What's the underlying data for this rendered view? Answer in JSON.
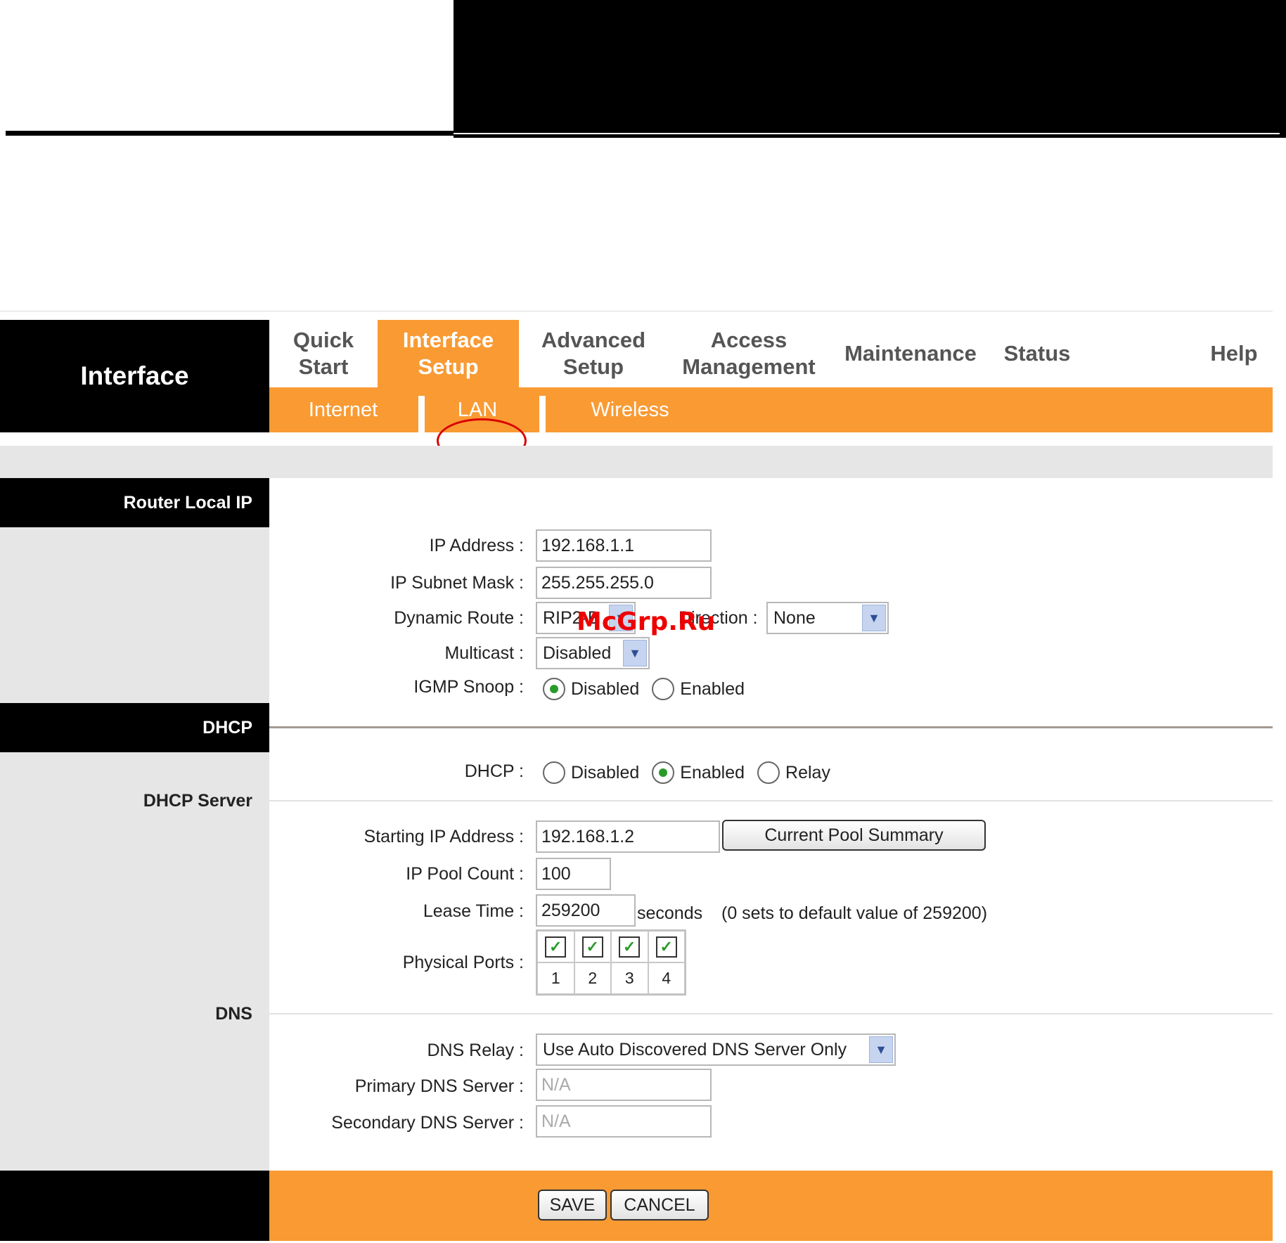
{
  "brand": {
    "title": "Interface"
  },
  "nav": {
    "tabs": [
      {
        "label": "Quick\nStart"
      },
      {
        "label": "Interface\nSetup"
      },
      {
        "label": "Advanced\nSetup"
      },
      {
        "label": "Access\nManagement"
      },
      {
        "label": "Maintenance"
      },
      {
        "label": "Status"
      },
      {
        "label": "Help"
      }
    ],
    "subtabs": [
      {
        "label": "Internet"
      },
      {
        "label": "LAN"
      },
      {
        "label": "Wireless"
      }
    ]
  },
  "sections": {
    "router_local_ip": "Router Local IP",
    "dhcp": "DHCP",
    "dhcp_server": "DHCP Server",
    "dns": "DNS"
  },
  "lan": {
    "ip_address": {
      "label": "IP Address :",
      "value": "192.168.1.1"
    },
    "subnet_mask": {
      "label": "IP Subnet Mask :",
      "value": "255.255.255.0"
    },
    "dynamic_route": {
      "label": "Dynamic Route :",
      "value": "RIP2-B"
    },
    "direction": {
      "label": "Direction :",
      "value": "None"
    },
    "multicast": {
      "label": "Multicast :",
      "value": "Disabled"
    },
    "igmp_snoop": {
      "label": "IGMP Snoop :",
      "options": [
        "Disabled",
        "Enabled"
      ],
      "selected": "Disabled"
    }
  },
  "dhcp": {
    "mode": {
      "label": "DHCP :",
      "options": [
        "Disabled",
        "Enabled",
        "Relay"
      ],
      "selected": "Enabled"
    },
    "starting_ip": {
      "label": "Starting IP Address :",
      "value": "192.168.1.2"
    },
    "pool_summary_button": "Current Pool Summary",
    "pool_count": {
      "label": "IP Pool Count :",
      "value": "100"
    },
    "lease_time": {
      "label": "Lease Time :",
      "value": "259200",
      "unit": "seconds",
      "hint": "(0 sets to default value of 259200)"
    },
    "physical_ports": {
      "label": "Physical Ports :",
      "ports": [
        "1",
        "2",
        "3",
        "4"
      ],
      "checked": [
        true,
        true,
        true,
        true
      ]
    }
  },
  "dns": {
    "relay": {
      "label": "DNS Relay :",
      "value": "Use Auto Discovered DNS Server Only"
    },
    "primary": {
      "label": "Primary DNS Server :",
      "value": "N/A"
    },
    "secondary": {
      "label": "Secondary DNS Server :",
      "value": "N/A"
    }
  },
  "footer": {
    "save": "SAVE",
    "cancel": "CANCEL"
  },
  "watermark": "McGrp.Ru",
  "colors": {
    "accent": "#f99a33",
    "header": "#000000",
    "panel": "#e6e6e6"
  },
  "icons": {
    "dropdown": "chevron-down-icon",
    "checkbox": "checkmark-icon",
    "annotation": "red-circle-annotation"
  }
}
